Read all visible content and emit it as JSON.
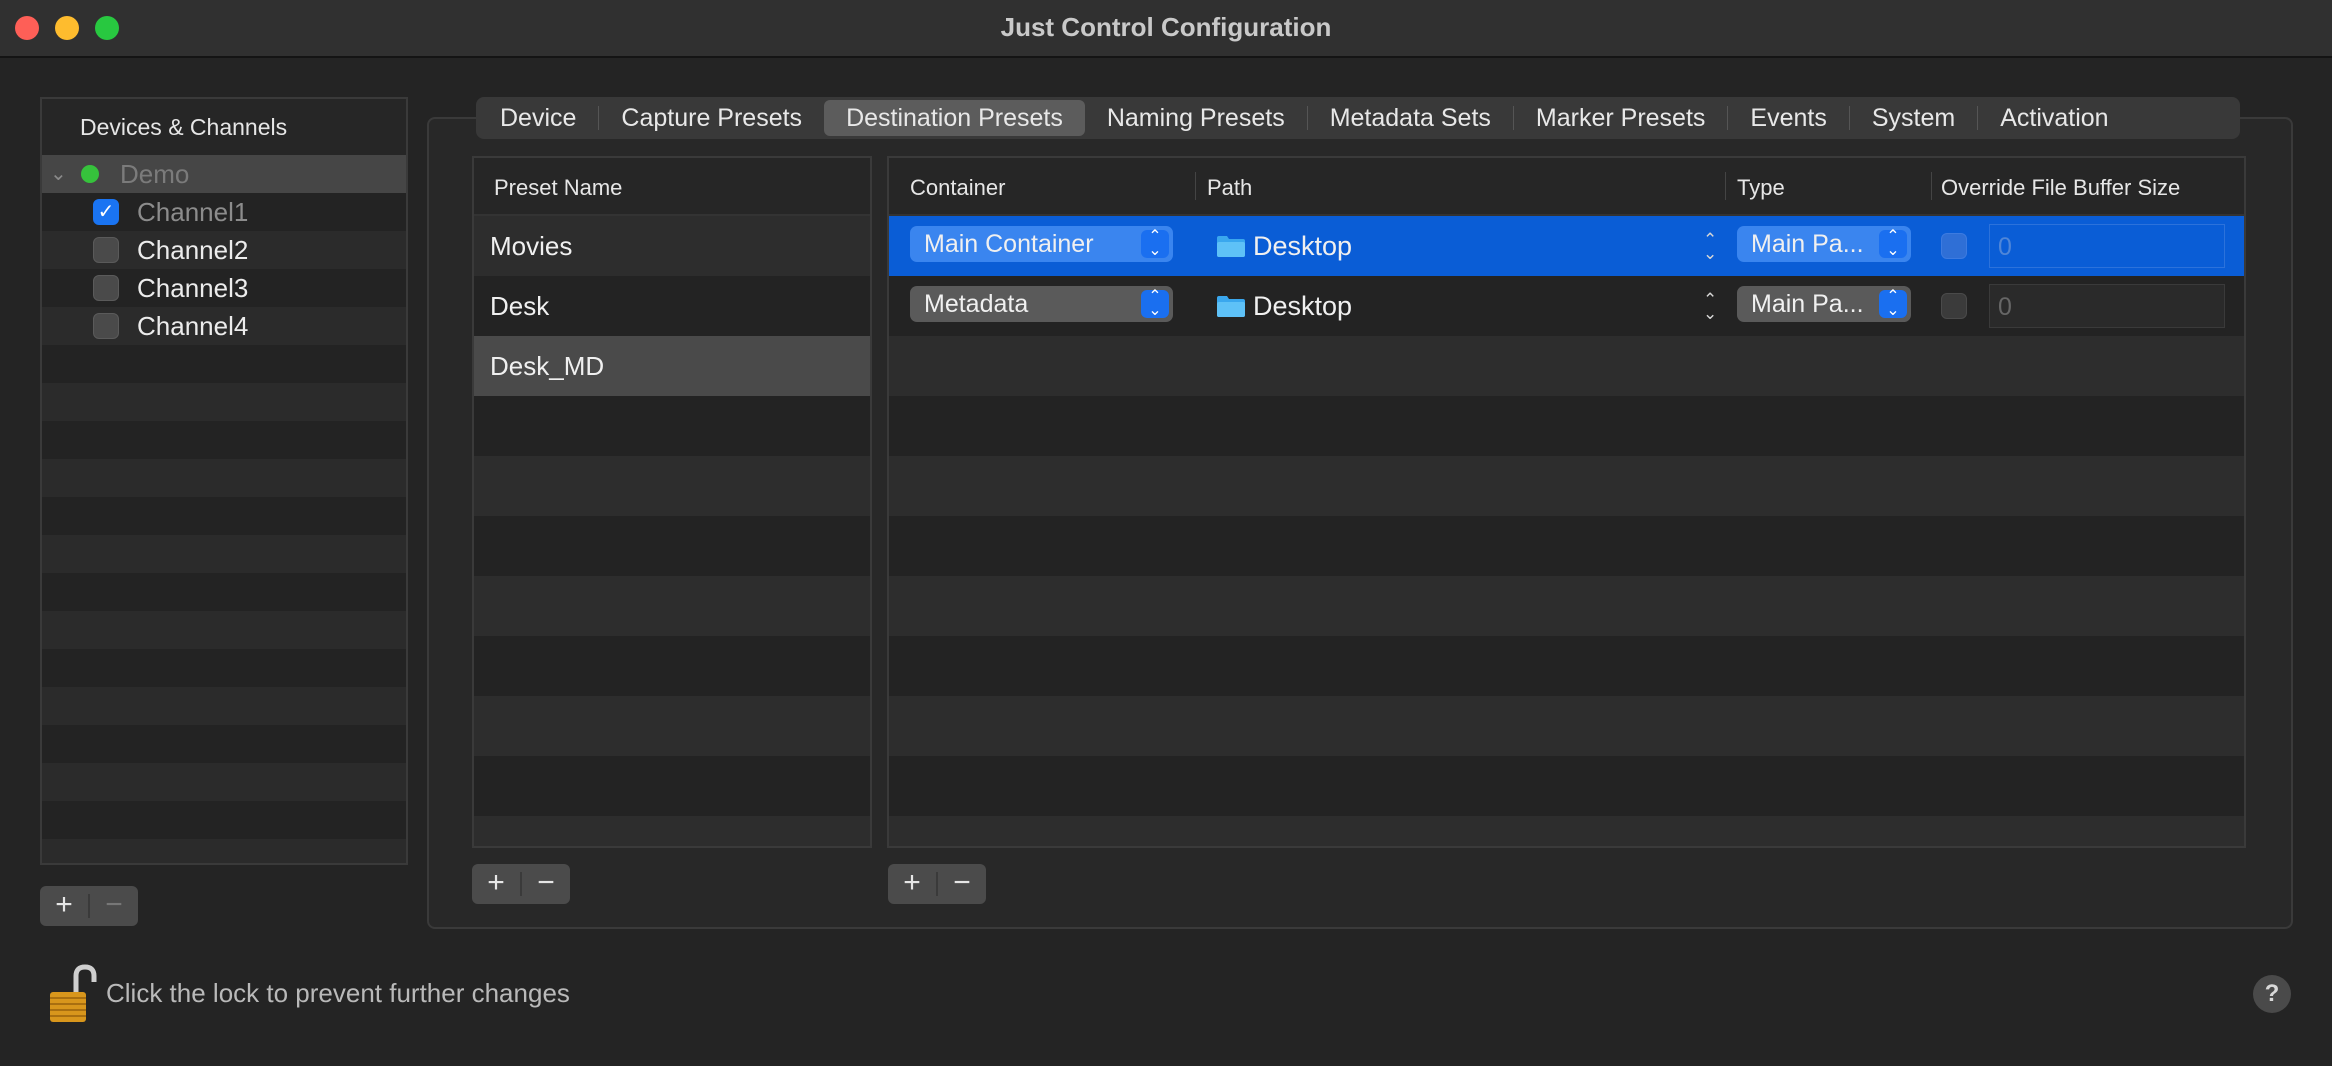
{
  "window": {
    "title": "Just Control Configuration"
  },
  "sidebar": {
    "header": "Devices & Channels",
    "device": {
      "label": "Demo",
      "status_color": "#36c23c"
    },
    "channels": [
      {
        "label": "Channel1",
        "checked": true
      },
      {
        "label": "Channel2",
        "checked": false
      },
      {
        "label": "Channel3",
        "checked": false
      },
      {
        "label": "Channel4",
        "checked": false
      }
    ],
    "add_label": "+",
    "remove_label": "−"
  },
  "tabs": [
    {
      "label": "Device"
    },
    {
      "label": "Capture Presets"
    },
    {
      "label": "Destination Presets",
      "active": true
    },
    {
      "label": "Naming Presets"
    },
    {
      "label": "Metadata Sets"
    },
    {
      "label": "Marker Presets"
    },
    {
      "label": "Events"
    },
    {
      "label": "System"
    },
    {
      "label": "Activation"
    }
  ],
  "presets": {
    "header": "Preset Name",
    "rows": [
      {
        "label": "Movies"
      },
      {
        "label": "Desk"
      },
      {
        "label": "Desk_MD",
        "selected": true
      }
    ],
    "add_label": "+",
    "remove_label": "−"
  },
  "destinations": {
    "columns": {
      "container": "Container",
      "path": "Path",
      "type": "Type",
      "override": "Override File Buffer Size"
    },
    "rows": [
      {
        "container": "Main Container",
        "path": "Desktop",
        "type": "Main Pa...",
        "override": false,
        "buffer": "0",
        "selected": true
      },
      {
        "container": "Metadata",
        "path": "Desktop",
        "type": "Main Pa...",
        "override": false,
        "buffer": "0",
        "selected": false
      }
    ],
    "add_label": "+",
    "remove_label": "−"
  },
  "footer": {
    "lock_message": "Click the lock to prevent further changes",
    "help_label": "?"
  },
  "colors": {
    "accent": "#0a5dd6",
    "checkbox_accent": "#1a74f2"
  }
}
